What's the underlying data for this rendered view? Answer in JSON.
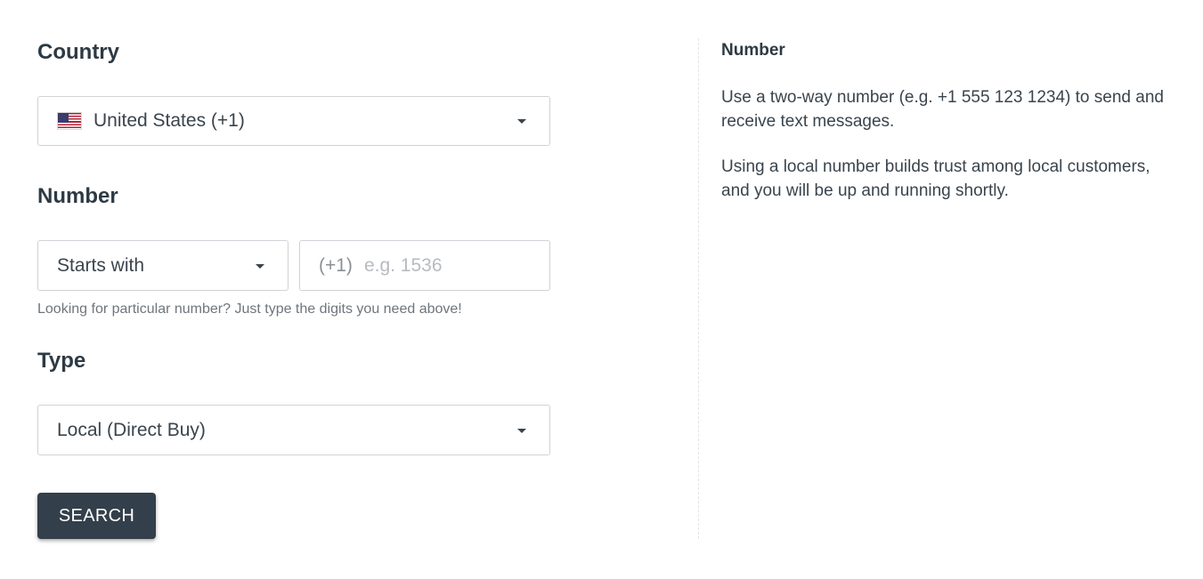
{
  "form": {
    "country": {
      "title": "Country",
      "selected": "United States (+1)",
      "flag": "us-flag-icon"
    },
    "number": {
      "title": "Number",
      "match_selected": "Starts with",
      "prefix": "(+1)",
      "placeholder": "e.g. 1536",
      "hint": "Looking for particular number? Just type the digits you need above!"
    },
    "type": {
      "title": "Type",
      "selected": "Local (Direct Buy)"
    },
    "search_label": "SEARCH"
  },
  "help": {
    "title": "Number",
    "paragraphs": [
      "Use a two-way number (e.g. +1 555 123 1234) to send and receive text messages.",
      "Using a local number builds trust among local customers, and you will be up and running shortly."
    ]
  },
  "colors": {
    "button_bg": "#333f4a",
    "text": "#33404a",
    "border": "#cfd3d7"
  }
}
